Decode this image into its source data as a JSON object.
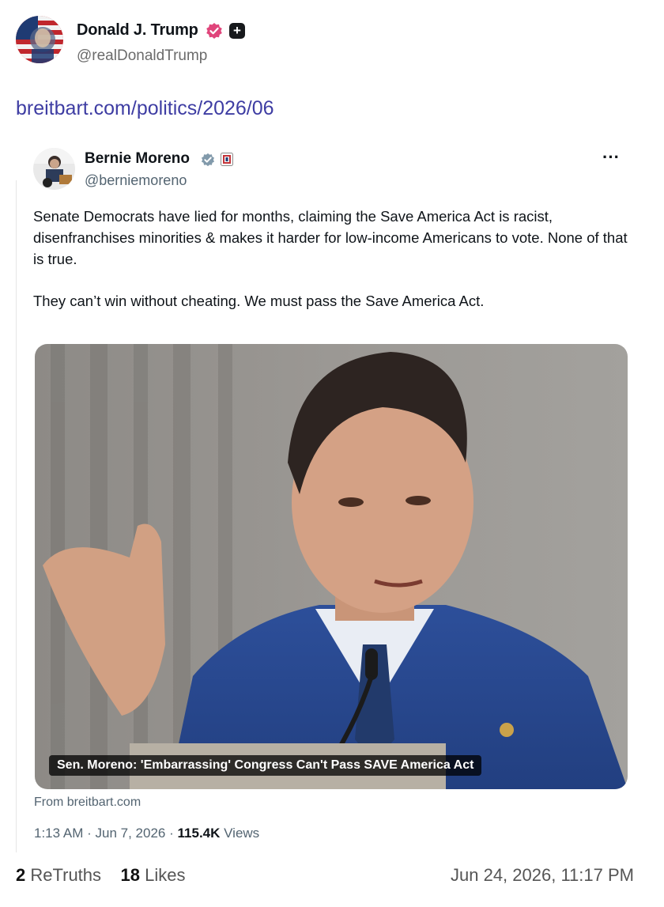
{
  "post": {
    "author_name": "Donald J. Trump",
    "author_handle": "@realDonaldTrump",
    "link_text": "breitbart.com/politics/2026/06",
    "avatar_icon": "flag-portrait-avatar",
    "verified_icon": "verified-badge-icon",
    "verified_color": "#e0457b",
    "plus_label": "+"
  },
  "embed": {
    "author_name": "Bernie Moreno",
    "author_handle": "@berniemoreno",
    "more_label": "···",
    "paragraph_1": "Senate Democrats have lied for months, claiming the Save America Act is racist, disenfranchises minorities & makes it harder for low-income Americans to vote. None of that is true.",
    "paragraph_2": "They can’t win without cheating. We must pass the Save America Act.",
    "media_caption": "Sen. Moreno: 'Embarrassing' Congress Can't Pass SAVE America Act",
    "source": "From breitbart.com",
    "time": "1:13 AM",
    "date": "Jun 7, 2026",
    "views_count": "115.4K",
    "views_label": "Views",
    "separator": "·",
    "verified_color": "#829aab"
  },
  "footer": {
    "retruths_count": "2",
    "retruths_label": "ReTruths",
    "likes_count": "18",
    "likes_label": "Likes",
    "timestamp": "Jun 24, 2026, 11:17 PM"
  }
}
